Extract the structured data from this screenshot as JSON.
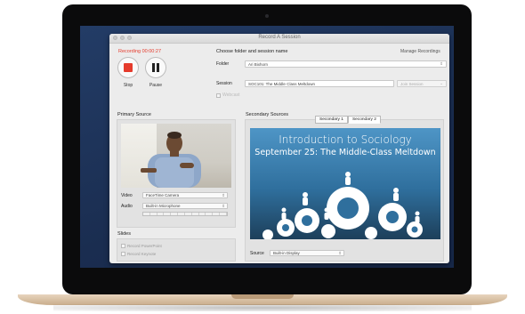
{
  "window": {
    "title": "Record A Session"
  },
  "recorder": {
    "status": "Recording 00:00:27",
    "stop_label": "Stop",
    "pause_label": "Pause"
  },
  "session_panel": {
    "heading": "Choose folder and session name",
    "manage_link": "Manage Recordings",
    "folder_label": "Folder",
    "folder_value": "Ari Bixhorn",
    "session_label": "Session",
    "session_value": "SOC101: The Middle Class Meltdown",
    "join_label": "Join Session",
    "webcast_label": "Webcast"
  },
  "primary_source": {
    "heading": "Primary Source",
    "video_label": "Video",
    "video_value": "FaceTime Camera",
    "audio_label": "Audio",
    "audio_value": "Built-in Microphone"
  },
  "slides": {
    "heading": "Slides",
    "option1": "Record PowerPoint",
    "option2": "Record Keynote"
  },
  "secondary_sources": {
    "heading": "Secondary Sources",
    "tabs": [
      {
        "label": "Secondary 1"
      },
      {
        "label": "Secondary 2"
      }
    ],
    "slide_title": "Introduction to Sociology",
    "slide_subtitle": "September 25: The Middle-Class Meltdown",
    "source_label": "Source",
    "source_value": "Built-in Display"
  },
  "colors": {
    "record_red": "#e53b2c",
    "slide_blue": "#3f86b8",
    "desktop_blue": "#1d3157"
  }
}
